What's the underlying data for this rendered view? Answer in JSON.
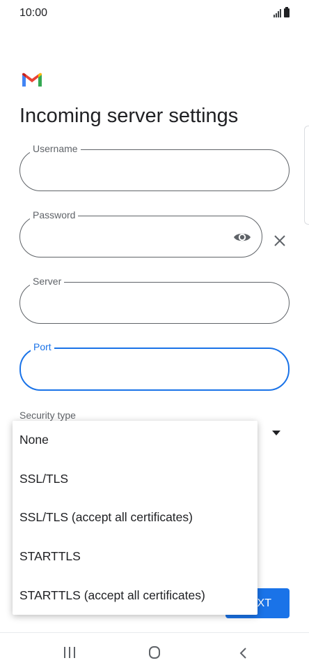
{
  "status_bar": {
    "time": "10:00"
  },
  "page": {
    "title": "Incoming server settings"
  },
  "fields": {
    "username": {
      "label": "Username",
      "value": ""
    },
    "password": {
      "label": "Password",
      "value": ""
    },
    "server": {
      "label": "Server",
      "value": ""
    },
    "port": {
      "label": "Port",
      "value": ""
    }
  },
  "security": {
    "label": "Security type",
    "options": [
      "None",
      "SSL/TLS",
      "SSL/TLS (accept all certificates)",
      "STARTTLS",
      "STARTTLS (accept all certificates)"
    ]
  },
  "next_button": {
    "label": "XT"
  },
  "colors": {
    "accent": "#1a73e8",
    "outline": "#5f6368",
    "text": "#202124"
  },
  "icons": [
    "gmail-logo-icon",
    "eye-icon",
    "close-icon",
    "dropdown-arrow-icon",
    "recent-apps-icon",
    "home-icon",
    "back-icon"
  ]
}
